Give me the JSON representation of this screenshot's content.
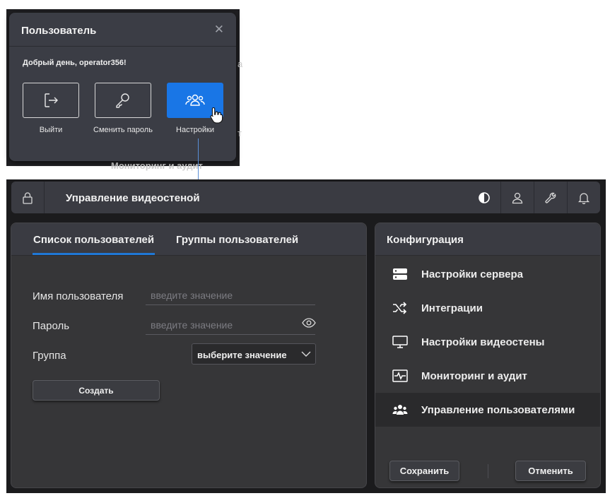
{
  "popup": {
    "title": "Пользователь",
    "close_glyph": "✕",
    "greeting": "Добрый день, operator356!",
    "actions": [
      {
        "label": "Выйти",
        "icon": "logout-icon"
      },
      {
        "label": "Сменить пароль",
        "icon": "key-icon"
      },
      {
        "label": "Настройки",
        "icon": "users-icon",
        "active": true
      }
    ],
    "background_fragments": [
      "а",
      "т",
      "Мониторинг и аудит"
    ]
  },
  "topbar": {
    "title": "Управление видеостеной",
    "icons": [
      "lock-icon",
      "contrast-icon",
      "user-icon",
      "wrench-icon",
      "bell-icon"
    ]
  },
  "users_panel": {
    "tabs": [
      {
        "label": "Список пользователей",
        "active": true
      },
      {
        "label": "Группы пользователей",
        "active": false
      }
    ],
    "username_label": "Имя пользователя",
    "username_placeholder": "введите значение",
    "password_label": "Пароль",
    "password_placeholder": "введите значение",
    "group_label": "Группа",
    "group_value": "выберите значение",
    "create_button": "Создать"
  },
  "config_panel": {
    "title": "Конфигурация",
    "items": [
      {
        "label": "Настройки сервера",
        "icon": "server-icon"
      },
      {
        "label": "Интеграции",
        "icon": "shuffle-icon"
      },
      {
        "label": "Настройки видеостены",
        "icon": "monitor-icon"
      },
      {
        "label": "Мониторинг и аудит",
        "icon": "activity-icon"
      },
      {
        "label": "Управление пользователями",
        "icon": "users-icon",
        "active": true
      }
    ],
    "save_button": "Сохранить",
    "cancel_button": "Отменить"
  },
  "colors": {
    "accent": "#1976e6",
    "panel_bg": "#363638",
    "topbar_bg": "#3a3b42"
  }
}
